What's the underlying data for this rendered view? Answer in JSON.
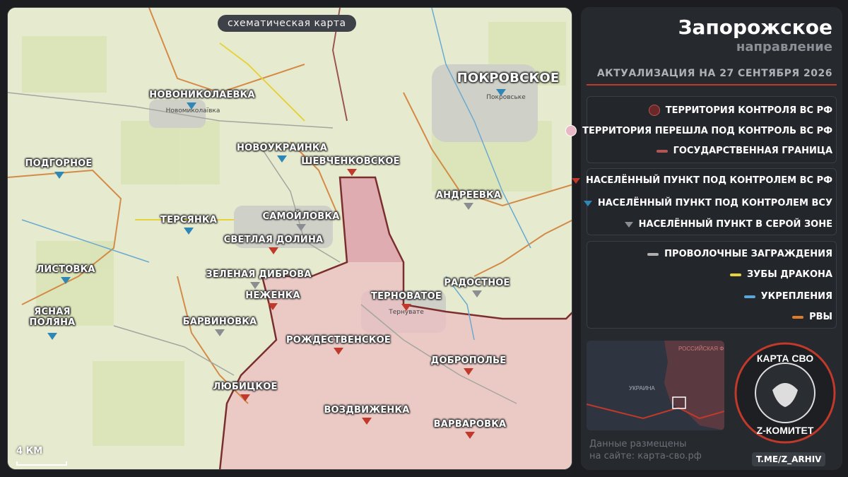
{
  "map": {
    "title": "схематическая карта",
    "scale_label": "4 КМ",
    "cities": [
      {
        "name": "Новониколаевка",
        "sub": "Новомиколаївка",
        "control": "ua"
      },
      {
        "name": "Покровское",
        "sub": "Покровське",
        "control": "ua",
        "big": true
      },
      {
        "name": "Подгорное",
        "control": "ua"
      },
      {
        "name": "Новоукраинка",
        "control": "ua"
      },
      {
        "name": "Шевченковское",
        "control": "ru"
      },
      {
        "name": "Андреевка",
        "control": "grey"
      },
      {
        "name": "Самойловка",
        "control": "grey"
      },
      {
        "name": "Терсянка",
        "control": "ua"
      },
      {
        "name": "Светлая Долина",
        "control": "ru"
      },
      {
        "name": "Листовка",
        "control": "ua"
      },
      {
        "name": "Зеленая Диброва",
        "control": "grey"
      },
      {
        "name": "Радостное",
        "control": "grey"
      },
      {
        "name": "Неженка",
        "control": "ru"
      },
      {
        "name": "Терноватое",
        "sub": "Тернувате",
        "control": "ru"
      },
      {
        "name": "Ясная Поляна",
        "control": "ua"
      },
      {
        "name": "Барвиновка",
        "control": "grey"
      },
      {
        "name": "Рождественское",
        "control": "ru"
      },
      {
        "name": "Доброполье",
        "control": "ru"
      },
      {
        "name": "Любицкое",
        "control": "ru"
      },
      {
        "name": "Воздвиженка",
        "control": "ru"
      },
      {
        "name": "Варваровка",
        "control": "ru"
      }
    ]
  },
  "header": {
    "title": "Запорожское",
    "subtitle": "направление",
    "update": "АКТУАЛИЗАЦИЯ НА 27 СЕНТЯБРЯ 2026"
  },
  "legend": {
    "territory": [
      {
        "label": "ТЕРРИТОРИЯ КОНТРОЛЯ ВС РФ",
        "color": "#7a2e2e"
      },
      {
        "label": "ТЕРРИТОРИЯ ПЕРЕШЛА ПОД КОНТРОЛЬ ВС РФ",
        "color": "#e8b8c4"
      },
      {
        "label": "ГОСУДАРСТВЕННАЯ ГРАНИЦА",
        "color": "#b35555"
      }
    ],
    "settlements": [
      {
        "label": "НАСЕЛЁННЫЙ ПУНКТ ПОД КОНТРОЛЕМ ВС РФ",
        "color": "#c0392b"
      },
      {
        "label": "НАСЕЛЁННЫЙ ПУНКТ ПОД КОНТРОЛЕМ ВСУ",
        "color": "#2f87b8"
      },
      {
        "label": "НАСЕЛЁННЫЙ ПУНКТ В СЕРОЙ ЗОНЕ",
        "color": "#8a8d92"
      }
    ],
    "fortifications": [
      {
        "label": "ПРОВОЛОЧНЫЕ ЗАГРАЖДЕНИЯ",
        "color": "#b0b0b0"
      },
      {
        "label": "ЗУБЫ ДРАКОНА",
        "color": "#e6d23a"
      },
      {
        "label": "УКРЕПЛЕНИЯ",
        "color": "#5aa6d6"
      },
      {
        "label": "РВЫ",
        "color": "#e07b2a"
      }
    ]
  },
  "minimap": {
    "label_ru": "РОССИЙСКАЯ ФЕДЕРАЦИЯ",
    "label_ua": "УКРАИНА"
  },
  "footer": {
    "site_note_line1": "Данные размещены",
    "site_note_line2": "на сайте: карта-сво.рф",
    "telegram": "T.ME/Z_ARHIV"
  },
  "logo": {
    "top": "КАРТА СВО",
    "bottom": "Z-КОМИТЕТ"
  }
}
